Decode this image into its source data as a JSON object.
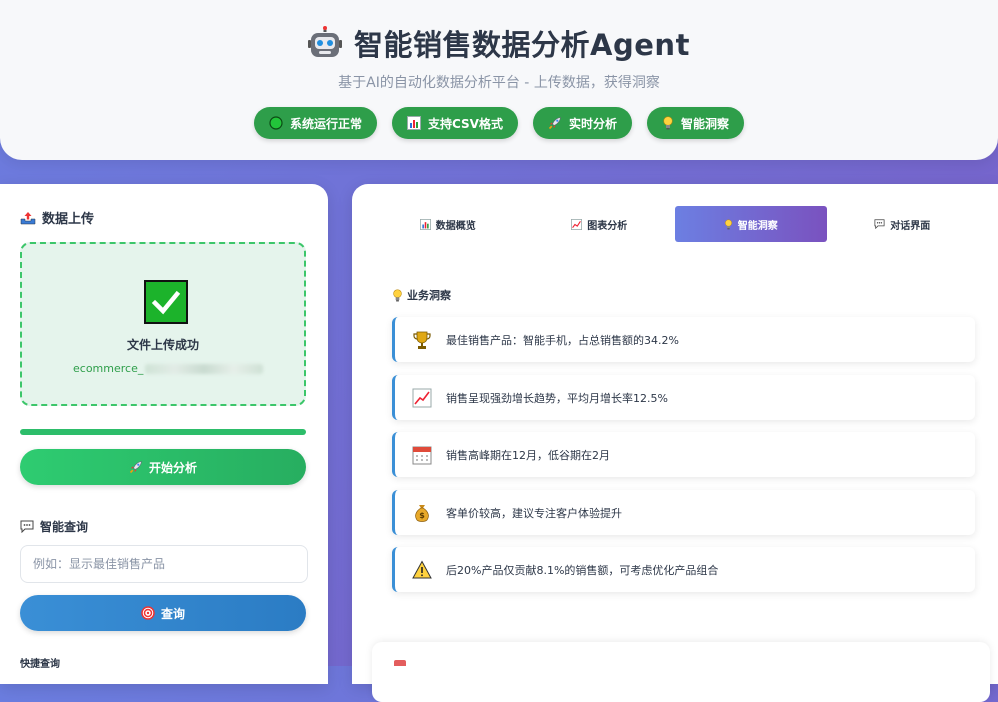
{
  "header": {
    "title": "智能销售数据分析Agent",
    "subtitle": "基于AI的自动化数据分析平台 - 上传数据，获得洞察",
    "pills": [
      {
        "label": "系统运行正常",
        "icon": "green-circle-icon"
      },
      {
        "label": "支持CSV格式",
        "icon": "bar-chart-icon"
      },
      {
        "label": "实时分析",
        "icon": "rocket-icon"
      },
      {
        "label": "智能洞察",
        "icon": "lightbulb-icon"
      }
    ]
  },
  "sidebar": {
    "upload_title": "数据上传",
    "upload_status": "文件上传成功",
    "upload_filename": "ecommerce_",
    "progress": 1.0,
    "start_button": "开始分析",
    "query_title": "智能查询",
    "query_placeholder": "例如：显示最佳销售产品",
    "query_button": "查询",
    "quick_title": "快捷查询"
  },
  "main": {
    "tabs": [
      {
        "label": "数据概览",
        "icon": "bar-chart-icon",
        "active": false
      },
      {
        "label": "图表分析",
        "icon": "line-chart-icon",
        "active": false
      },
      {
        "label": "智能洞察",
        "icon": "lightbulb-icon",
        "active": true
      },
      {
        "label": "对话界面",
        "icon": "speech-bubble-icon",
        "active": false
      }
    ],
    "insights_title": "业务洞察",
    "insights": [
      {
        "icon": "trophy-icon",
        "text": "最佳销售产品：智能手机，占总销售额的34.2%"
      },
      {
        "icon": "trend-up-icon",
        "text": "销售呈现强劲增长趋势，平均月增长率12.5%"
      },
      {
        "icon": "calendar-icon",
        "text": "销售高峰期在12月，低谷期在2月"
      },
      {
        "icon": "money-bag-icon",
        "text": "客单价较高，建议专注客户体验提升"
      },
      {
        "icon": "warning-icon",
        "text": "后20%产品仅贡献8.1%的销售额，可考虑优化产品组合"
      }
    ]
  },
  "colors": {
    "accent_green": "#2e9e4a",
    "accent_blue": "#3a8fd6",
    "tab_active_start": "#6c7fe2",
    "tab_active_end": "#7a52bf",
    "background_start": "#6b7ee0",
    "background_end": "#7a5bc4"
  }
}
